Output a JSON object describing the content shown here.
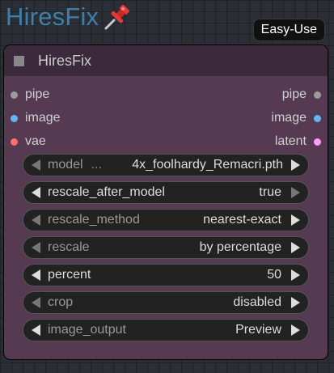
{
  "group": {
    "title": "HiresFix",
    "badge": "Easy-Use",
    "pin_icon": "pushpin-icon"
  },
  "node": {
    "title": "HiresFix",
    "colors": {
      "body": "#553a52",
      "header": "#3b2a3b"
    },
    "inputs": [
      {
        "label": "pipe",
        "color": "#b5b5b5"
      },
      {
        "label": "image",
        "color": "#64b5f6"
      },
      {
        "label": "vae",
        "color": "#ff6e6e"
      }
    ],
    "outputs": [
      {
        "label": "pipe",
        "color": "#b5b5b5"
      },
      {
        "label": "image",
        "color": "#64b5f6"
      },
      {
        "label": "latent",
        "color": "#ff9cf9"
      }
    ],
    "widgets": [
      {
        "label": "model",
        "separator": "...",
        "value": "4x_foolhardy_Remacri.pth"
      },
      {
        "label": "rescale_after_model",
        "value": "true"
      },
      {
        "label": "rescale_method",
        "value": "nearest-exact"
      },
      {
        "label": "rescale",
        "value": "by percentage"
      },
      {
        "label": "percent",
        "value": "50"
      },
      {
        "label": "crop",
        "value": "disabled"
      },
      {
        "label": "image_output",
        "value": "Preview"
      }
    ]
  }
}
